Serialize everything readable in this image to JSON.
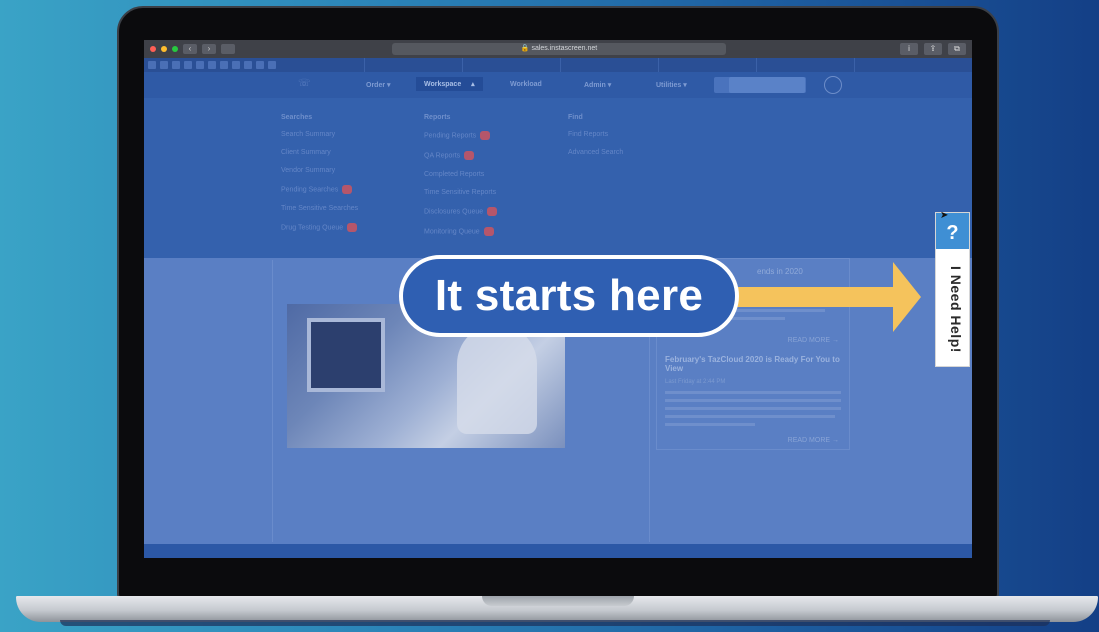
{
  "browser": {
    "url": "sales.instascreen.net",
    "tabs": [
      "",
      "",
      "",
      "",
      "",
      ""
    ]
  },
  "app_nav": {
    "items": [
      "Order",
      "Workspace",
      "Workload",
      "Admin",
      "Utilities"
    ],
    "workspace_badge": ""
  },
  "mega_menu": {
    "columns": [
      {
        "heading": "Searches",
        "items": [
          "Search Summary",
          "Client Summary",
          "Vendor Summary",
          "Pending Searches",
          "Time Sensitive Searches",
          "Drug Testing Queue"
        ]
      },
      {
        "heading": "Reports",
        "items": [
          "Pending Reports",
          "QA Reports",
          "Completed Reports",
          "Time Sensitive Reports",
          "Disclosures Queue",
          "Monitoring Queue"
        ]
      },
      {
        "heading": "Find",
        "items": [
          "Find Reports",
          "Advanced Search"
        ]
      }
    ]
  },
  "news": {
    "top_heading_fragment": "ends in 2020",
    "read_more": "READ MORE →",
    "article_title": "February's TazCloud 2020 is Ready For You to View",
    "article_date": "Last Friday at 2:44 PM",
    "read_more_2": "READ MORE →"
  },
  "callout": {
    "text": "It starts here"
  },
  "help_tab": {
    "icon_text": "?",
    "label": "I Need Help!"
  },
  "colors": {
    "background_start": "#3aa3c6",
    "background_end": "#143f86",
    "overlay_blue": "#2f5aa6",
    "arrow": "#f5c35c",
    "help_blue": "#3f8fd4"
  }
}
